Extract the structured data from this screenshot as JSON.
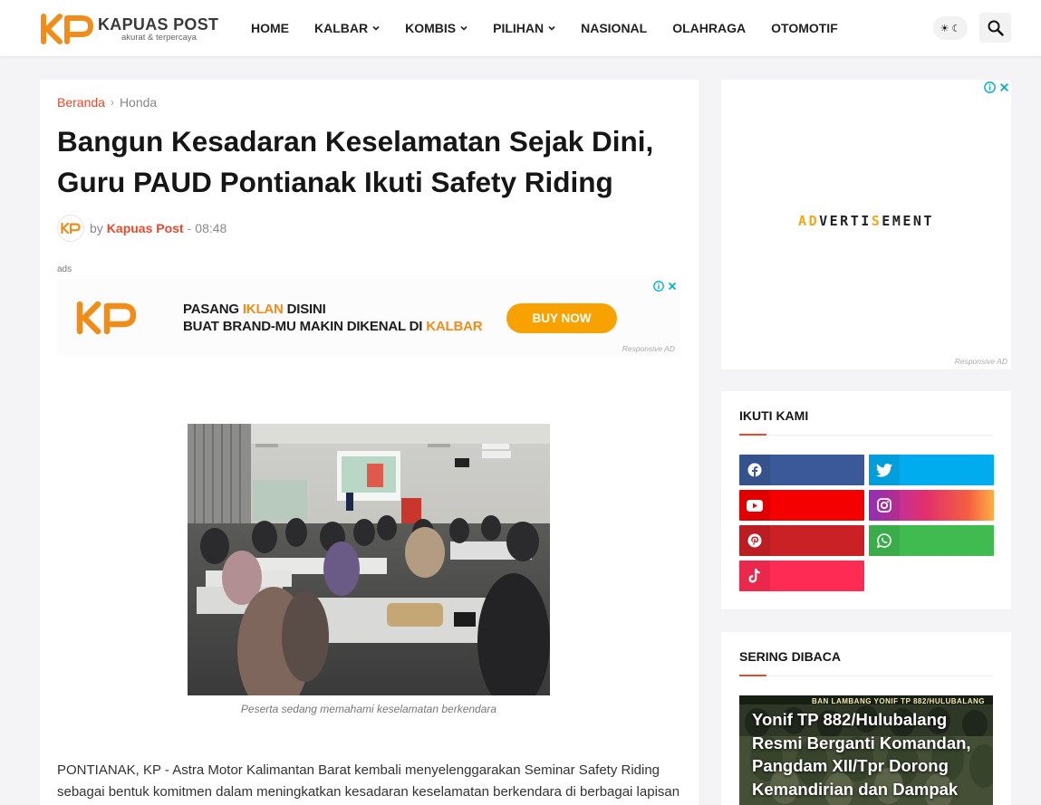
{
  "header": {
    "logo_mark": "KP",
    "logo_name": "KAPUAS POST",
    "logo_tagline": "akurat & terpercaya",
    "nav": [
      {
        "label": "HOME",
        "dropdown": false
      },
      {
        "label": "KALBAR",
        "dropdown": true
      },
      {
        "label": "KOMBIS",
        "dropdown": true
      },
      {
        "label": "PILIHAN",
        "dropdown": true
      },
      {
        "label": "NASIONAL",
        "dropdown": false
      },
      {
        "label": "OLAHRAGA",
        "dropdown": false
      },
      {
        "label": "OTOMOTIF",
        "dropdown": false
      }
    ],
    "theme_toggle_icon": "sun-moon-icon",
    "search_icon": "search-icon"
  },
  "article": {
    "breadcrumb": {
      "home": "Beranda",
      "current": "Honda"
    },
    "title": "Bangun Kesadaran Keselamatan Sejak Dini, Guru PAUD Pontianak Ikuti Safety Riding",
    "meta": {
      "by": "by",
      "author": "Kapuas Post",
      "separator": "-",
      "time": "08:48"
    },
    "ads_label": "ads",
    "ad_banner": {
      "logo": "KP",
      "line1_pre": "PASANG ",
      "line1_hl": "IKLAN",
      "line1_post": " DISINI",
      "line2_pre": "BUAT BRAND-MU MAKIN DIKENAL DI ",
      "line2_hl": "KALBAR",
      "button": "BUY NOW",
      "responsive": "Responsive AD"
    },
    "image_caption": "Peserta sedang memahami keselamatan berkendara",
    "body_text": "PONTIANAK, KP - Astra Motor Kalimantan Barat kembali menyelenggarakan Seminar Safety Riding sebagai bentuk komitmen dalam meningkatkan kesadaran keselamatan berkendara di berbagai lapisan"
  },
  "sidebar": {
    "ad": {
      "letters": [
        "A",
        "D",
        "V",
        "E",
        "R",
        "T",
        "I",
        "S",
        "E",
        "M",
        "E",
        "N",
        "T"
      ],
      "highlight_indices": [
        0,
        1,
        7
      ],
      "responsive": "Responsive AD"
    },
    "follow": {
      "title": "IKUTI KAMI",
      "buttons": [
        {
          "network": "facebook",
          "icon": "facebook-icon",
          "color": "#3b5999"
        },
        {
          "network": "twitter",
          "icon": "twitter-icon",
          "color": "#00acee"
        },
        {
          "network": "youtube",
          "icon": "youtube-icon",
          "color": "#f50000"
        },
        {
          "network": "instagram",
          "icon": "instagram-icon",
          "color": "#e1306c"
        },
        {
          "network": "pinterest",
          "icon": "pinterest-icon",
          "color": "#ca2127"
        },
        {
          "network": "whatsapp",
          "icon": "whatsapp-icon",
          "color": "#3fbb50"
        },
        {
          "network": "tiktok",
          "icon": "tiktok-icon",
          "color": "#fe2c55"
        }
      ]
    },
    "popular": {
      "title": "SERING DIBACA",
      "top_banner_text": "BAN LAMBANG YONIF TP 882/HULUBALANG",
      "post_title": "Yonif TP 882/Hulubalang Resmi Berganti Komandan, Pangdam XII/Tpr Dorong Kemandirian dan Dampak"
    }
  },
  "colors": {
    "accent": "#e8492b",
    "brand_orange": "#f28c18",
    "buy_now": "#f7a200"
  }
}
